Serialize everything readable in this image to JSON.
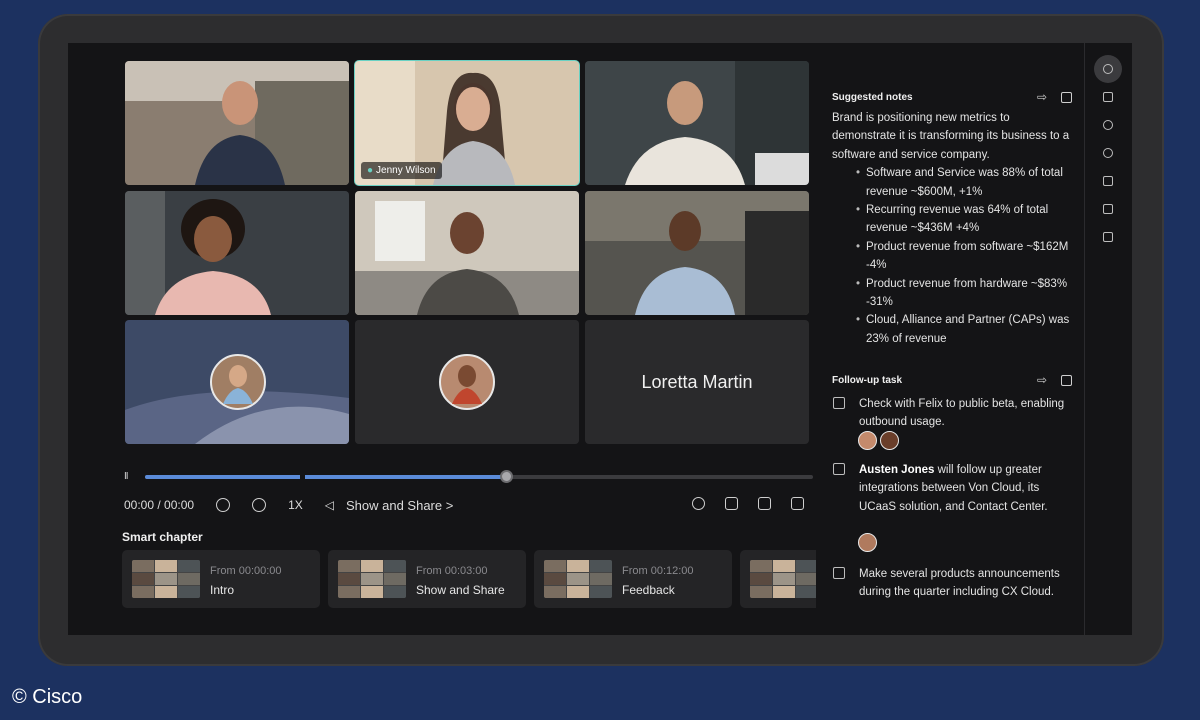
{
  "video": {
    "active_speaker": "Jenny Wilson",
    "placeholder_name": "Loretta Martin"
  },
  "player": {
    "time": "00:00 / 00:00",
    "speed": "1X",
    "share_label": "Show and Share",
    "share_chevron": ">",
    "pause_glyph": "II",
    "progress": 0.54
  },
  "smart_chapter": {
    "title": "Smart chapter",
    "items": [
      {
        "from": "From 00:00:00",
        "label": "Intro"
      },
      {
        "from": "From 00:03:00",
        "label": "Show and Share"
      },
      {
        "from": "From 00:12:00",
        "label": "Feedback"
      }
    ]
  },
  "notes": {
    "title": "Suggested notes",
    "intro": "Brand is positioning new metrics to demonstrate it is transforming its business to a software and service company.",
    "bullets": [
      "Software and Service was 88% of total revenue ~$600M, +1%",
      "Recurring revenue was 64% of total revenue ~$436M +4%",
      "Product revenue from software ~$162M -4%",
      "Product revenue from hardware ~$83% -31%",
      "Cloud, Alliance and Partner (CAPs) was 23% of revenue"
    ]
  },
  "followup": {
    "title": "Follow-up task",
    "tasks": [
      {
        "bold": "",
        "text": "Check with Felix to public beta, enabling outbound usage."
      },
      {
        "bold": "Austen Jones",
        "text": " will follow up greater integrations between Von Cloud, its UCaaS solution, and Contact Center."
      },
      {
        "bold": "",
        "text": "Make several products announcements during the quarter including CX Cloud."
      }
    ]
  },
  "icons": {
    "sidebar": [
      "lightbulb-icon",
      "list-icon",
      "people-icon",
      "chat-icon",
      "question-icon",
      "chart-icon",
      "bookmark-icon"
    ],
    "section": [
      "share-arrow-icon",
      "copy-icon"
    ]
  },
  "footer": {
    "copyright": "© Cisco"
  },
  "colors": {
    "accent": "#6ad1c3",
    "progress": "#5b8bd8",
    "background": "#1c3160"
  }
}
